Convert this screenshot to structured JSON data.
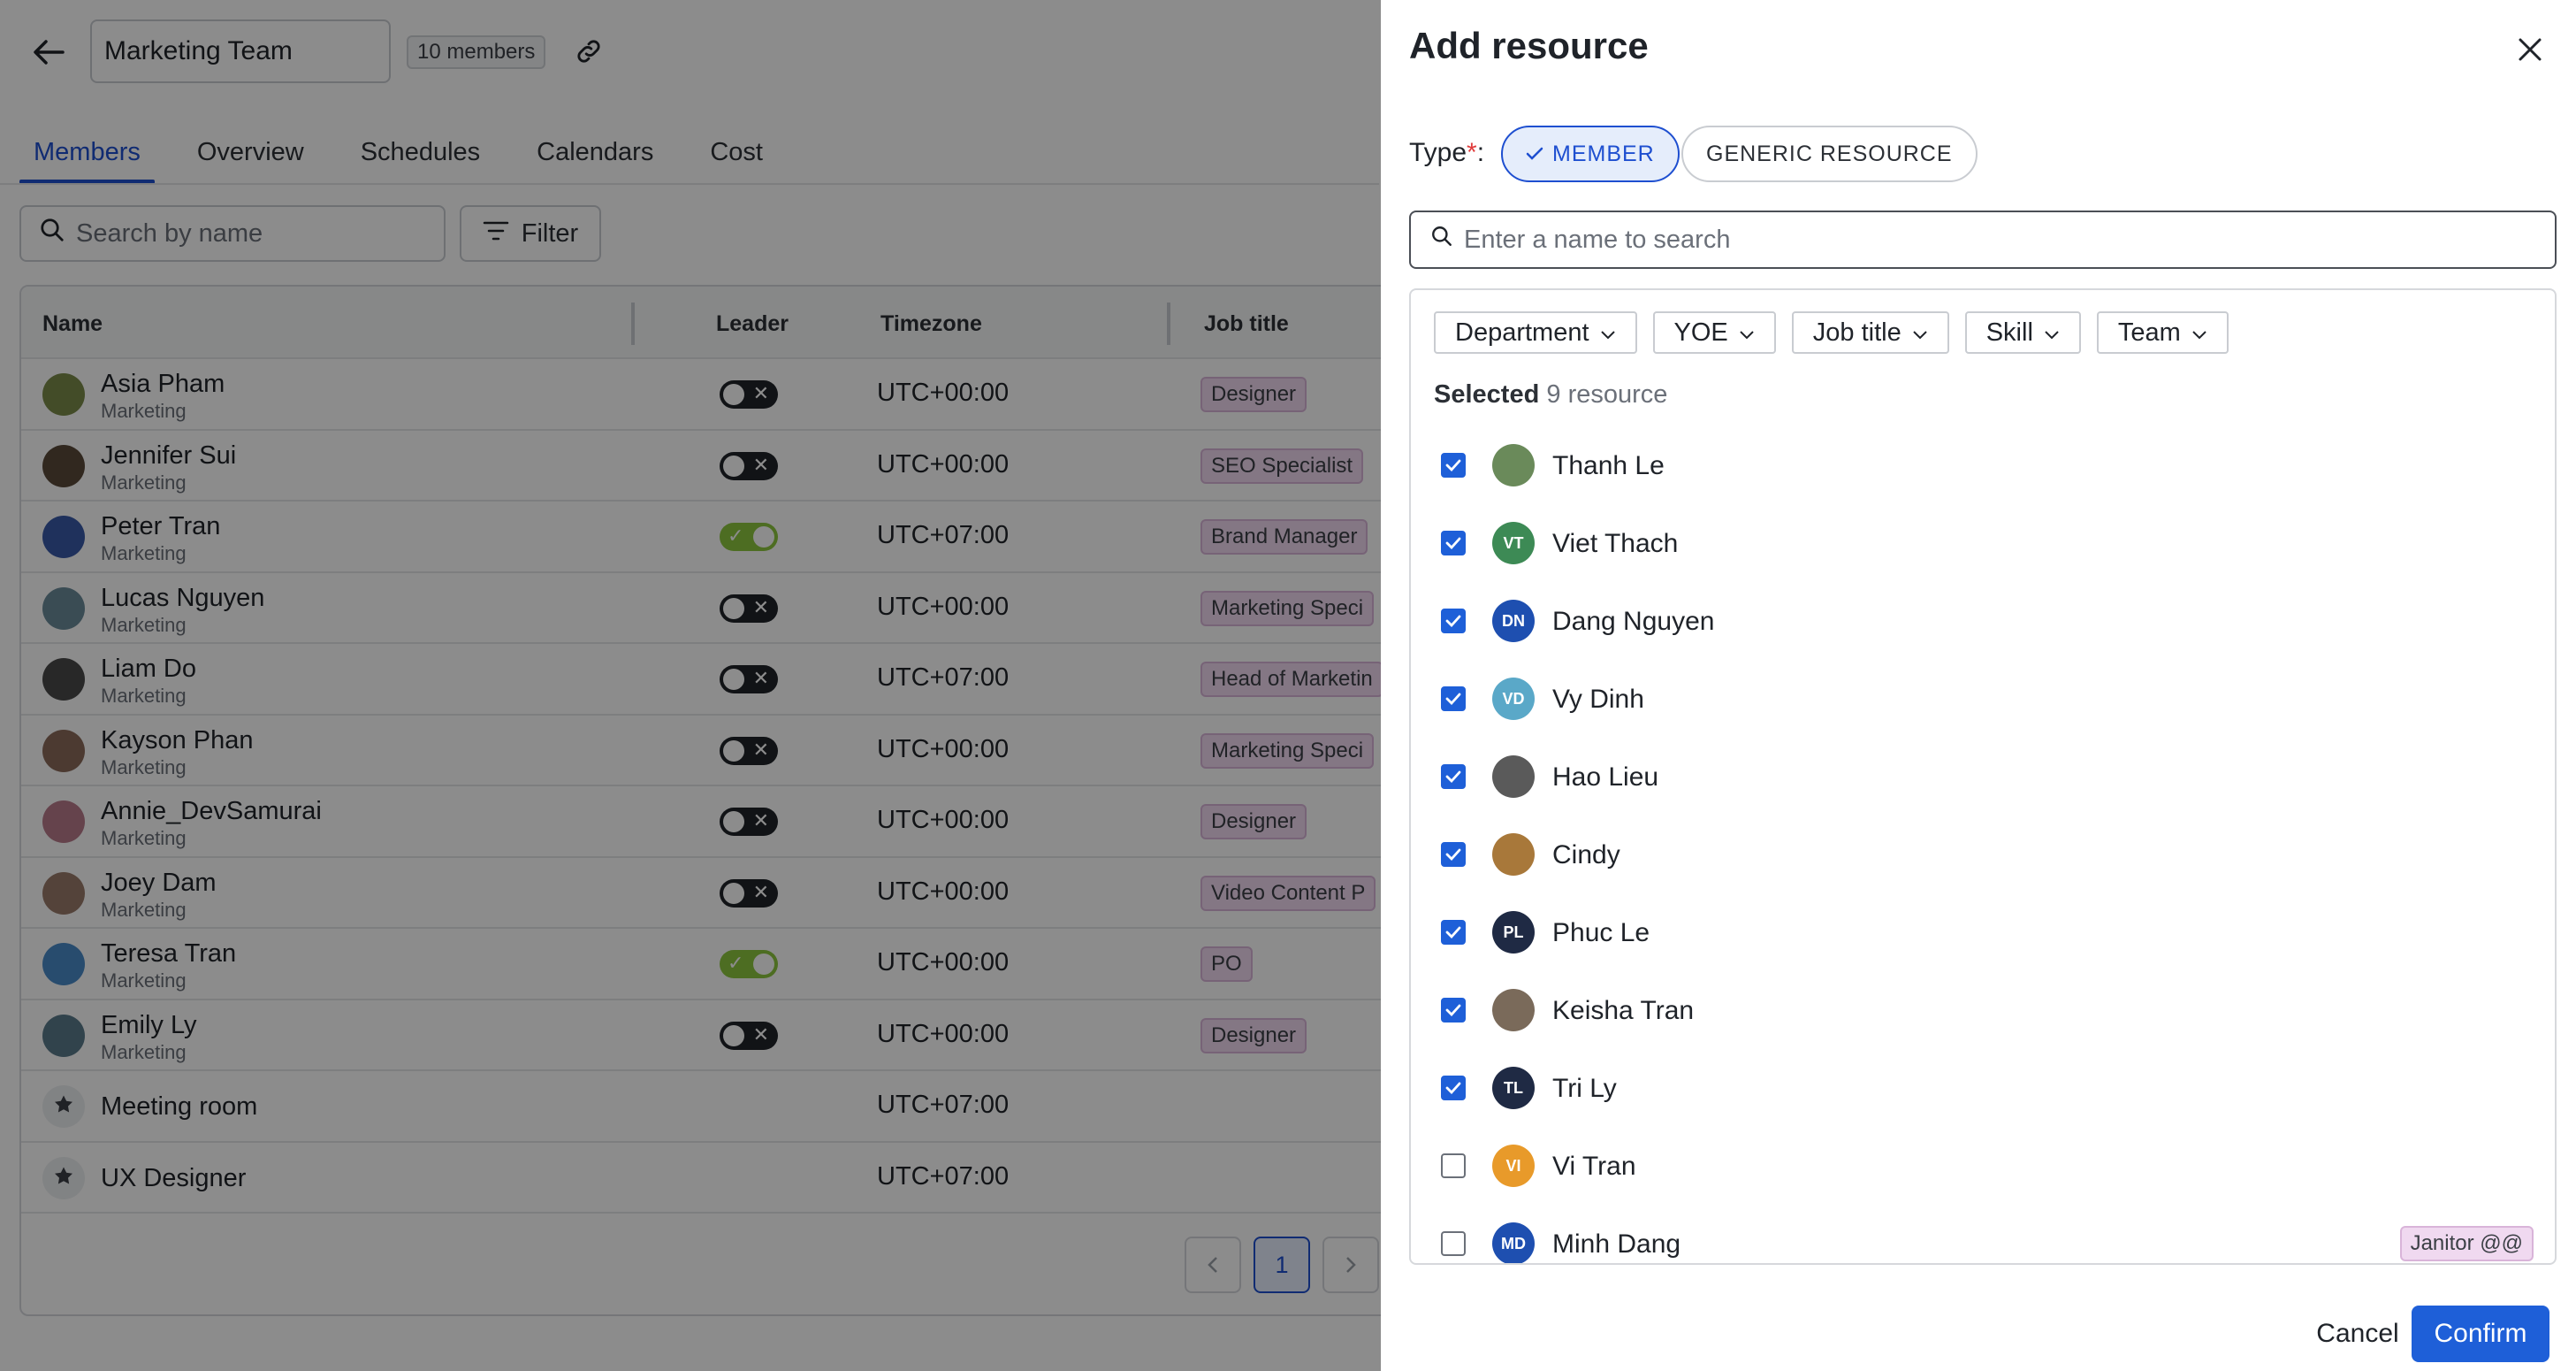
{
  "header": {
    "team_name": "Marketing Team",
    "member_count": "10 members"
  },
  "tabs": [
    {
      "label": "Members",
      "active": true
    },
    {
      "label": "Overview"
    },
    {
      "label": "Schedules"
    },
    {
      "label": "Calendars"
    },
    {
      "label": "Cost"
    }
  ],
  "toolbar": {
    "search_placeholder": "Search by name",
    "filter_label": "Filter"
  },
  "table": {
    "headers": {
      "name": "Name",
      "leader": "Leader",
      "timezone": "Timezone",
      "job_title": "Job title"
    },
    "rows": [
      {
        "name": "Asia Pham",
        "dept": "Marketing",
        "leader": false,
        "tz": "UTC+00:00",
        "job": "Designer",
        "avatar_color": "#7a8a4a"
      },
      {
        "name": "Jennifer Sui",
        "dept": "Marketing",
        "leader": false,
        "tz": "UTC+00:00",
        "job": "SEO Specialist",
        "avatar_color": "#5a4a3a"
      },
      {
        "name": "Peter Tran",
        "dept": "Marketing",
        "leader": true,
        "tz": "UTC+07:00",
        "job": "Brand Manager",
        "avatar_color": "#3a5aa8"
      },
      {
        "name": "Lucas Nguyen",
        "dept": "Marketing",
        "leader": false,
        "tz": "UTC+00:00",
        "job": "Marketing Speci",
        "avatar_color": "#6a8a9a"
      },
      {
        "name": "Liam Do",
        "dept": "Marketing",
        "leader": false,
        "tz": "UTC+07:00",
        "job": "Head of Marketin",
        "avatar_color": "#4a4a4a"
      },
      {
        "name": "Kayson Phan",
        "dept": "Marketing",
        "leader": false,
        "tz": "UTC+00:00",
        "job": "Marketing Speci",
        "avatar_color": "#8a6a5a"
      },
      {
        "name": "Annie_DevSamurai",
        "dept": "Marketing",
        "leader": false,
        "tz": "UTC+00:00",
        "job": "Designer",
        "avatar_color": "#b87a8a"
      },
      {
        "name": "Joey Dam",
        "dept": "Marketing",
        "leader": false,
        "tz": "UTC+00:00",
        "job": "Video Content P",
        "avatar_color": "#9a7a6a"
      },
      {
        "name": "Teresa Tran",
        "dept": "Marketing",
        "leader": true,
        "tz": "UTC+00:00",
        "job": "PO",
        "avatar_color": "#4a8ac8"
      },
      {
        "name": "Emily Ly",
        "dept": "Marketing",
        "leader": false,
        "tz": "UTC+00:00",
        "job": "Designer",
        "avatar_color": "#5a7a8a"
      },
      {
        "name": "Meeting room",
        "dept": "",
        "leader": null,
        "tz": "UTC+07:00",
        "job": "",
        "avatar_color": "#d6d8dc"
      },
      {
        "name": "UX Designer",
        "dept": "",
        "leader": null,
        "tz": "UTC+07:00",
        "job": "",
        "avatar_color": "#d6d8dc"
      }
    ]
  },
  "pagination": {
    "current": "1"
  },
  "drawer": {
    "title": "Add resource",
    "type_label": "Type",
    "type_required": "*",
    "type_suffix": ":",
    "type_member": "MEMBER",
    "type_generic": "GENERIC RESOURCE",
    "search_placeholder": "Enter a name to search",
    "filters": [
      "Department",
      "YOE",
      "Job title",
      "Skill",
      "Team"
    ],
    "selected_prefix": "Selected",
    "selected_count": "9",
    "selected_suffix": "resource",
    "resources": [
      {
        "name": "Thanh Le",
        "checked": true,
        "initials": "",
        "avatar_color": "#6a8a5a"
      },
      {
        "name": "Viet Thach",
        "checked": true,
        "initials": "VT",
        "avatar_color": "#3d8a55"
      },
      {
        "name": "Dang Nguyen",
        "checked": true,
        "initials": "DN",
        "avatar_color": "#1e4fb0"
      },
      {
        "name": "Vy Dinh",
        "checked": true,
        "initials": "VD",
        "avatar_color": "#5aa8c8"
      },
      {
        "name": "Hao Lieu",
        "checked": true,
        "initials": "",
        "avatar_color": "#5a5a5a"
      },
      {
        "name": "Cindy",
        "checked": true,
        "initials": "",
        "avatar_color": "#a8783a"
      },
      {
        "name": "Phuc Le",
        "checked": true,
        "initials": "PL",
        "avatar_color": "#1f2a44"
      },
      {
        "name": "Keisha Tran",
        "checked": true,
        "initials": "",
        "avatar_color": "#7a6a5a"
      },
      {
        "name": "Tri Ly",
        "checked": true,
        "initials": "TL",
        "avatar_color": "#1f2a44"
      },
      {
        "name": "Vi Tran",
        "checked": false,
        "initials": "VI",
        "avatar_color": "#e89a2a"
      },
      {
        "name": "Minh Dang",
        "checked": false,
        "initials": "MD",
        "avatar_color": "#1e4fb0",
        "tag": "Janitor @@"
      }
    ],
    "cancel_label": "Cancel",
    "confirm_label": "Confirm"
  },
  "colors": {
    "primary": "#1e5fd8",
    "tag_bg": "#f0d9f0"
  }
}
